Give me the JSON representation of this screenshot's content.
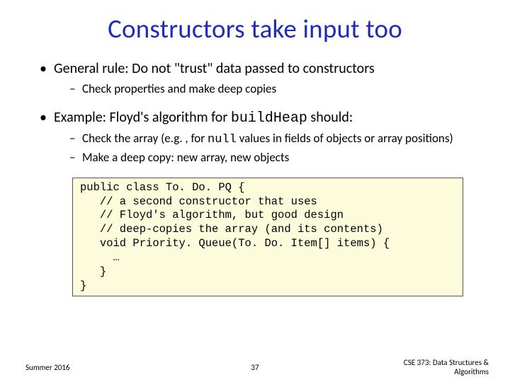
{
  "title": "Constructors take input too",
  "bullets": {
    "b1": "General rule: Do not \"trust\" data passed to constructors",
    "b1_sub1": "Check properties and make deep copies",
    "b2_pre": "Example: Floyd's algorithm for ",
    "b2_code": "buildHeap",
    "b2_post": " should:",
    "b2_sub1_pre": "Check the array (e.g. , for ",
    "b2_sub1_code": "null",
    "b2_sub1_post": " values in fields of objects or array positions)",
    "b2_sub2": "Make a deep copy: new array, new objects"
  },
  "code": {
    "l1": "public class To. Do. PQ {",
    "l2": "   // a second constructor that uses",
    "l3": "   // Floyd's algorithm, but good design",
    "l4": "   // deep-copies the array (and its contents)",
    "l5": "   void Priority. Queue(To. Do. Item[] items) {",
    "l6": "     …",
    "l7": "   }",
    "l8": "}"
  },
  "footer": {
    "left": "Summer 2016",
    "center": "37",
    "right1": "CSE 373: Data Structures &",
    "right2": "Algorithms"
  }
}
